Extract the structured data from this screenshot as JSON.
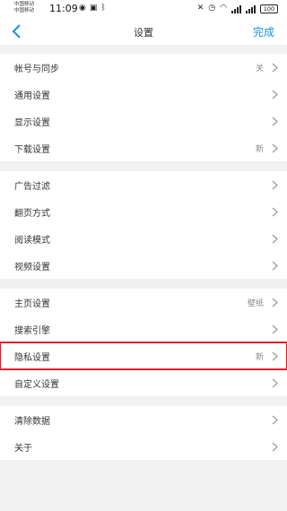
{
  "status_bar": {
    "carrier_1": "中国移动",
    "carrier_2": "中国移动",
    "time": "11:09",
    "battery": "100"
  },
  "nav": {
    "title": "设置",
    "done_label": "完成"
  },
  "groups": [
    {
      "rows": [
        {
          "label": "帐号与同步",
          "value": "关"
        },
        {
          "label": "通用设置",
          "value": ""
        },
        {
          "label": "显示设置",
          "value": ""
        },
        {
          "label": "下载设置",
          "value": "新"
        }
      ]
    },
    {
      "rows": [
        {
          "label": "广告过滤",
          "value": ""
        },
        {
          "label": "翻页方式",
          "value": ""
        },
        {
          "label": "阅读模式",
          "value": ""
        },
        {
          "label": "视频设置",
          "value": ""
        }
      ]
    },
    {
      "rows": [
        {
          "label": "主页设置",
          "value": "壁纸"
        },
        {
          "label": "搜索引擎",
          "value": ""
        },
        {
          "label": "隐私设置",
          "value": "新"
        },
        {
          "label": "自定义设置",
          "value": ""
        }
      ]
    },
    {
      "rows": [
        {
          "label": "清除数据",
          "value": ""
        },
        {
          "label": "关于",
          "value": ""
        }
      ]
    }
  ],
  "highlighted_row": "隐私设置",
  "colors": {
    "accent": "#1e8fd6",
    "highlight": "#e0202e",
    "background": "#f1f1f1"
  }
}
